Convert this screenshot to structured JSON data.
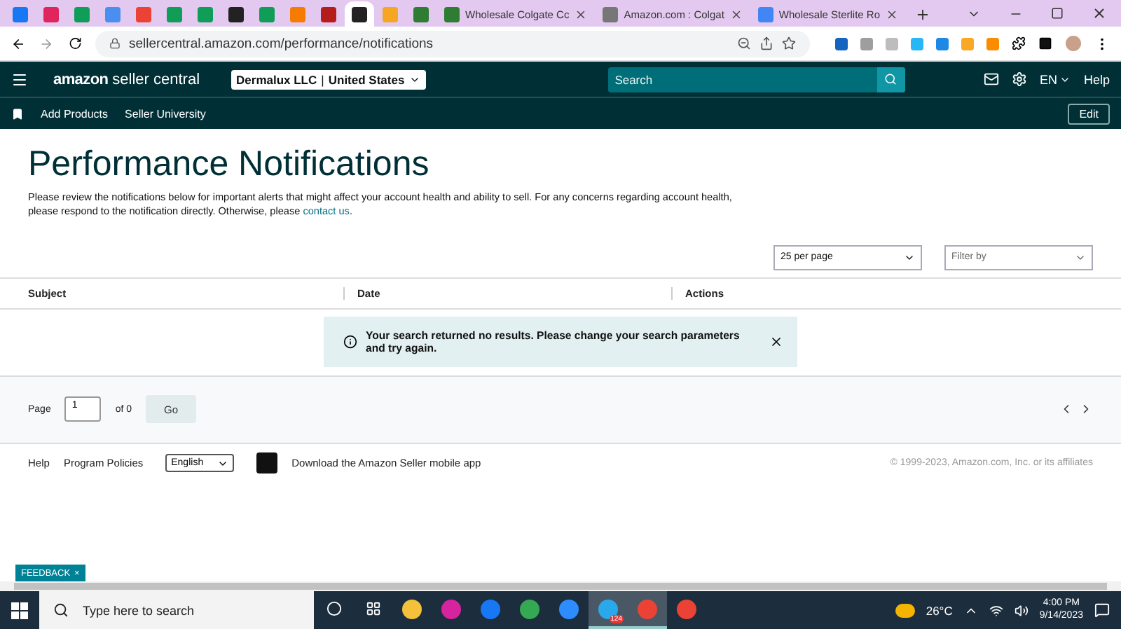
{
  "browser": {
    "tabs": [
      {
        "kind": "icon",
        "color": "#1877f2",
        "selected": false
      },
      {
        "kind": "icon",
        "color": "#e0245e",
        "selected": false
      },
      {
        "kind": "icon",
        "color": "#0f9d58",
        "selected": false
      },
      {
        "kind": "icon",
        "color": "#4a8ef0",
        "selected": false
      },
      {
        "kind": "icon",
        "color": "#ea4335",
        "selected": false
      },
      {
        "kind": "icon",
        "color": "#0f9d58",
        "selected": false
      },
      {
        "kind": "icon",
        "color": "#0f9d58",
        "selected": false
      },
      {
        "kind": "icon",
        "color": "#222222",
        "selected": false
      },
      {
        "kind": "icon",
        "color": "#0f9d58",
        "selected": false
      },
      {
        "kind": "icon",
        "color": "#f57c00",
        "selected": false
      },
      {
        "kind": "icon",
        "color": "#b71c1c",
        "selected": false
      },
      {
        "kind": "icon",
        "color": "#222222",
        "selected": true
      },
      {
        "kind": "icon",
        "color": "#f5a623",
        "selected": false
      },
      {
        "kind": "icon",
        "color": "#2e7d32",
        "selected": false
      },
      {
        "kind": "text",
        "color": "#2e7d32",
        "title": "Wholesale Colgate Cc",
        "selected": false
      },
      {
        "kind": "text",
        "color": "#777777",
        "title": "Amazon.com : Colgat",
        "selected": false
      },
      {
        "kind": "text",
        "color": "#4285f4",
        "title": "Wholesale Sterlite Ro",
        "selected": false
      }
    ],
    "address": "sellercentral.amazon.com/performance/notifications"
  },
  "header": {
    "logo": "amazon",
    "logo_suffix": "seller central",
    "account": "Dermalux LLC",
    "separator": "|",
    "marketplace": "United States",
    "search_placeholder": "Search",
    "language": "EN",
    "help": "Help"
  },
  "subnav": {
    "links": [
      "Add Products",
      "Seller University"
    ],
    "edit": "Edit"
  },
  "page": {
    "title": "Performance Notifications",
    "intro": "Please review the notifications below for important alerts that might affect your account health and ability to sell. For any concerns regarding account health, please respond to the notification directly. Otherwise, please ",
    "contact_link": "contact us",
    "intro_end": ".",
    "per_page": "25 per page",
    "filter_placeholder": "Filter by",
    "columns": [
      "Subject",
      "Date",
      "Actions"
    ],
    "alert": "Your search returned no results. Please change your search parameters and try again.",
    "pagination": {
      "label": "Page",
      "value": "1",
      "of": "of 0",
      "go": "Go"
    }
  },
  "footer": {
    "links": [
      "Help",
      "Program Policies"
    ],
    "language": "English",
    "app": "Download the Amazon Seller mobile app",
    "copyright": "© 1999-2023, Amazon.com, Inc. or its affiliates"
  },
  "feedback": {
    "label": "FEEDBACK",
    "close": "×"
  },
  "taskbar": {
    "search_placeholder": "Type here to search",
    "apps": [
      {
        "color": "#f3c13a",
        "selected": false
      },
      {
        "color": "#d6249f",
        "selected": false
      },
      {
        "color": "#1877f2",
        "selected": false
      },
      {
        "color": "#34a853",
        "selected": false
      },
      {
        "color": "#2d8cff",
        "selected": false
      },
      {
        "color": "#29a9eb",
        "selected": true,
        "badge": "124"
      },
      {
        "color": "#ea4335",
        "selected": true
      },
      {
        "color": "#ea4335",
        "selected": false
      }
    ],
    "temperature": "26°C",
    "time": "4:00 PM",
    "date": "9/14/2023"
  }
}
